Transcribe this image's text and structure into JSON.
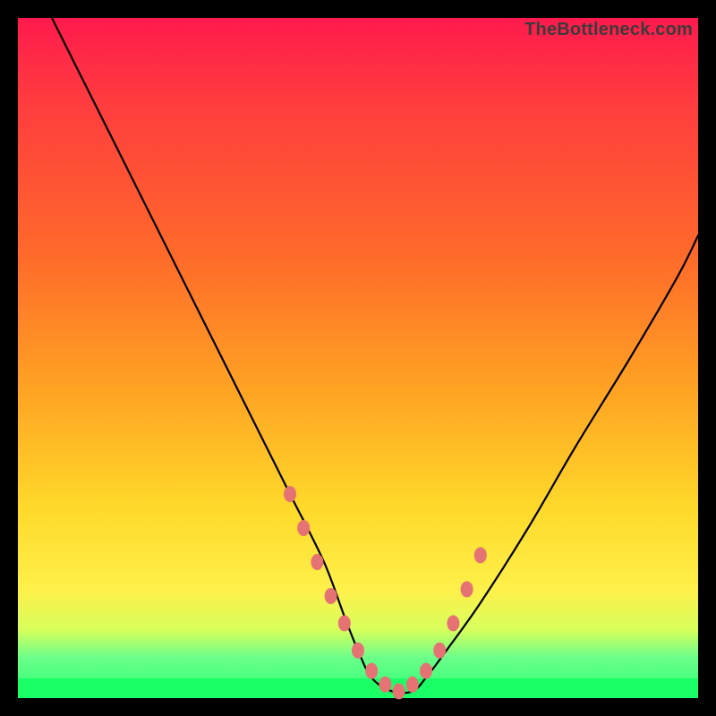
{
  "watermark": "TheBottleneck.com",
  "chart_data": {
    "type": "line",
    "title": "",
    "xlabel": "",
    "ylabel": "",
    "xlim": [
      0,
      100
    ],
    "ylim": [
      0,
      100
    ],
    "grid": false,
    "legend": false,
    "series": [
      {
        "name": "bottleneck-curve",
        "x": [
          5,
          10,
          15,
          20,
          25,
          30,
          35,
          40,
          45,
          48,
          50,
          52,
          55,
          58,
          60,
          63,
          68,
          75,
          82,
          90,
          97,
          100
        ],
        "y": [
          100,
          90,
          80,
          70,
          60,
          50,
          40,
          30,
          20,
          12,
          7,
          3,
          1,
          1,
          3,
          7,
          14,
          25,
          37,
          50,
          62,
          68
        ]
      }
    ],
    "highlight_points": {
      "name": "sample-dots",
      "x": [
        40,
        42,
        44,
        46,
        48,
        50,
        52,
        54,
        56,
        58,
        60,
        62,
        64,
        66,
        68
      ],
      "y": [
        30,
        25,
        20,
        15,
        11,
        7,
        4,
        2,
        1,
        2,
        4,
        7,
        11,
        16,
        21
      ]
    },
    "gradient_colors": {
      "top": "#ff1a4d",
      "mid_high": "#ffa423",
      "mid": "#ffd92a",
      "low": "#6cff8a",
      "bottom": "#1aff66"
    }
  }
}
